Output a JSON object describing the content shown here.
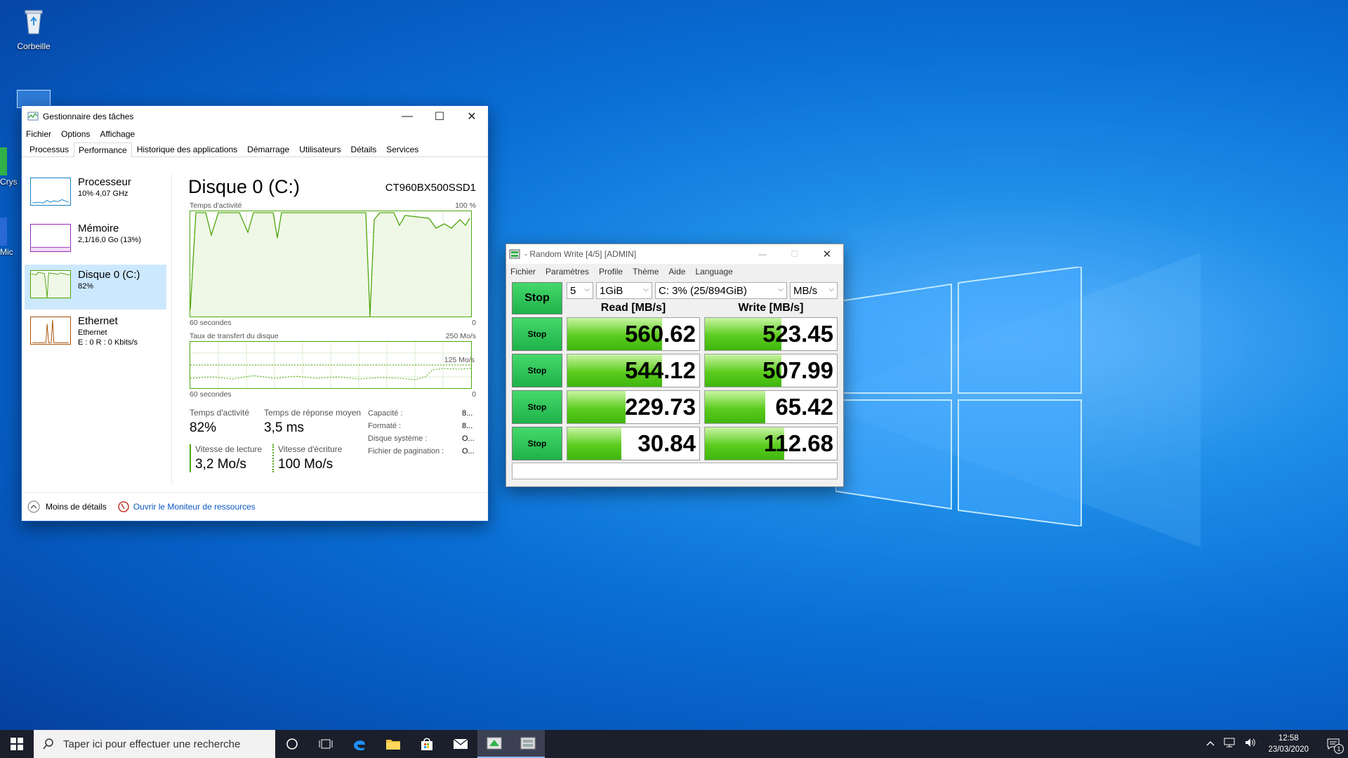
{
  "desktop": {
    "recycle_bin_label": "Corbeille",
    "partial_icon_1": "Crys",
    "partial_icon_2": "Mic"
  },
  "taskmgr": {
    "title": "Gestionnaire des tâches",
    "menu": [
      "Fichier",
      "Options",
      "Affichage"
    ],
    "tabs": [
      "Processus",
      "Performance",
      "Historique des applications",
      "Démarrage",
      "Utilisateurs",
      "Détails",
      "Services"
    ],
    "active_tab": "Performance",
    "sidebar": [
      {
        "title": "Processeur",
        "sub": "10% 4,07 GHz",
        "sub2": ""
      },
      {
        "title": "Mémoire",
        "sub": "2,1/16,0 Go (13%)",
        "sub2": ""
      },
      {
        "title": "Disque 0 (C:)",
        "sub": "82%",
        "sub2": ""
      },
      {
        "title": "Ethernet",
        "sub": "Ethernet",
        "sub2": "E : 0 R : 0 Kbits/s"
      }
    ],
    "disk_title": "Disque 0 (C:)",
    "disk_model": "CT960BX500SSD1",
    "graph1": {
      "label": "Temps d'activité",
      "max": "100 %",
      "time": "60 secondes",
      "min": "0"
    },
    "graph2": {
      "label": "Taux de transfert du disque",
      "max": "250 Mo/s",
      "mid": "125 Mo/s",
      "time": "60 secondes",
      "min": "0"
    },
    "stats": {
      "activity_label": "Temps d'activité",
      "activity_value": "82%",
      "response_label": "Temps de réponse moyen",
      "response_value": "3,5 ms",
      "read_label": "Vitesse de lecture",
      "read_value": "3,2 Mo/s",
      "write_label": "Vitesse d'écriture",
      "write_value": "100 Mo/s",
      "capacity_label": "Capacité :",
      "capacity_value": "8...",
      "formatted_label": "Formaté :",
      "formatted_value": "8...",
      "system_label": "Disque système :",
      "system_value": "O...",
      "pagefile_label": "Fichier de pagination :",
      "pagefile_value": "O..."
    },
    "fewer_details": "Moins de détails",
    "resource_monitor": "Ouvrir le Moniteur de ressources"
  },
  "cdm": {
    "title": "- Random Write [4/5] [ADMIN]",
    "menu": [
      "Fichier",
      "Paramètres",
      "Profile",
      "Thème",
      "Aide",
      "Language"
    ],
    "main_button": "Stop",
    "count": "5",
    "size": "1GiB",
    "drive": "C: 3% (25/894GiB)",
    "unit": "MB/s",
    "read_header": "Read [MB/s]",
    "write_header": "Write [MB/s]",
    "rows": [
      {
        "button": "Stop",
        "read": "560.62",
        "write": "523.45",
        "read_fill": 0.72,
        "write_fill": 0.58
      },
      {
        "button": "Stop",
        "read": "544.12",
        "write": "507.99",
        "read_fill": 0.72,
        "write_fill": 0.58
      },
      {
        "button": "Stop",
        "read": "229.73",
        "write": "65.42",
        "read_fill": 0.44,
        "write_fill": 0.46
      },
      {
        "button": "Stop",
        "read": "30.84",
        "write": "112.68",
        "read_fill": 0.41,
        "write_fill": 0.6
      }
    ],
    "status": ""
  },
  "taskbar": {
    "search_placeholder": "Taper ici pour effectuer une recherche",
    "time": "12:58",
    "date": "23/03/2020",
    "notification_count": "1"
  }
}
